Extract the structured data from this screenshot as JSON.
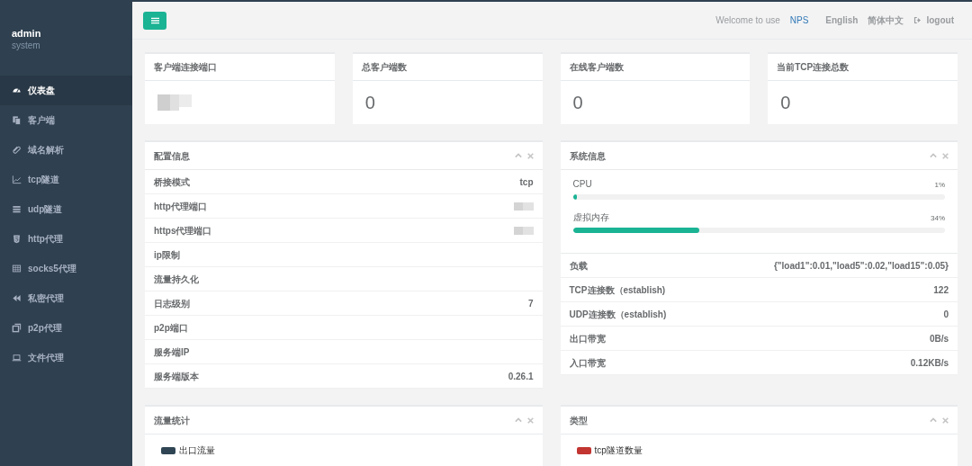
{
  "sidebar": {
    "user": "admin",
    "role": "system",
    "items": [
      {
        "label": "仪表盘",
        "selected": true
      },
      {
        "label": "客户端",
        "selected": false
      },
      {
        "label": "域名解析",
        "selected": false
      },
      {
        "label": "tcp隧道",
        "selected": false
      },
      {
        "label": "udp隧道",
        "selected": false
      },
      {
        "label": "http代理",
        "selected": false
      },
      {
        "label": "socks5代理",
        "selected": false
      },
      {
        "label": "私密代理",
        "selected": false
      },
      {
        "label": "p2p代理",
        "selected": false
      },
      {
        "label": "文件代理",
        "selected": false
      }
    ]
  },
  "topbar": {
    "welcome": "Welcome to use",
    "brand": "NPS",
    "links": [
      "English",
      "简体中文"
    ],
    "logout": "logout"
  },
  "stat_cards": [
    {
      "title": "客户端连接端口",
      "kind": "redacted"
    },
    {
      "title": "总客户端数",
      "kind": "text",
      "value": "0"
    },
    {
      "title": "在线客户端数",
      "kind": "text",
      "value": "0"
    },
    {
      "title": "当前TCP连接总数",
      "kind": "text",
      "value": "0"
    }
  ],
  "config_panel": {
    "title": "配置信息",
    "rows": [
      {
        "label": "桥接模式",
        "kind": "text",
        "value": "tcp"
      },
      {
        "label": "http代理端口",
        "kind": "redacted"
      },
      {
        "label": "https代理端口",
        "kind": "redacted"
      },
      {
        "label": "ip限制",
        "kind": "blank"
      },
      {
        "label": "流量持久化",
        "kind": "blank"
      },
      {
        "label": "日志级别",
        "kind": "text",
        "value": "7"
      },
      {
        "label": "p2p端口",
        "kind": "blank"
      },
      {
        "label": "服务端IP",
        "kind": "blank"
      },
      {
        "label": "服务端版本",
        "kind": "text",
        "value": "0.26.1"
      }
    ]
  },
  "system_panel": {
    "title": "系统信息",
    "meters": [
      {
        "label": "CPU",
        "reading": "1%",
        "level": 0.01
      },
      {
        "label": "虚拟内存",
        "reading": "34%",
        "level": 0.34
      }
    ],
    "rows": [
      {
        "label": "负载",
        "value": "{\"load1\":0.01,\"load5\":0.02,\"load15\":0.05}"
      },
      {
        "label": "TCP连接数（establish)",
        "value": "122"
      },
      {
        "label": "UDP连接数（establish)",
        "value": "0"
      },
      {
        "label": "出口带宽",
        "value": "0B/s"
      },
      {
        "label": "入口带宽",
        "value": "0.12KB/s"
      }
    ]
  },
  "bottom_panels": [
    {
      "title": "流量统计",
      "legend": [
        {
          "label": "出口流量",
          "color": "#2f4554"
        }
      ]
    },
    {
      "title": "类型",
      "legend": [
        {
          "label": "tcp隧道数量",
          "color": "#c23531"
        }
      ]
    }
  ]
}
